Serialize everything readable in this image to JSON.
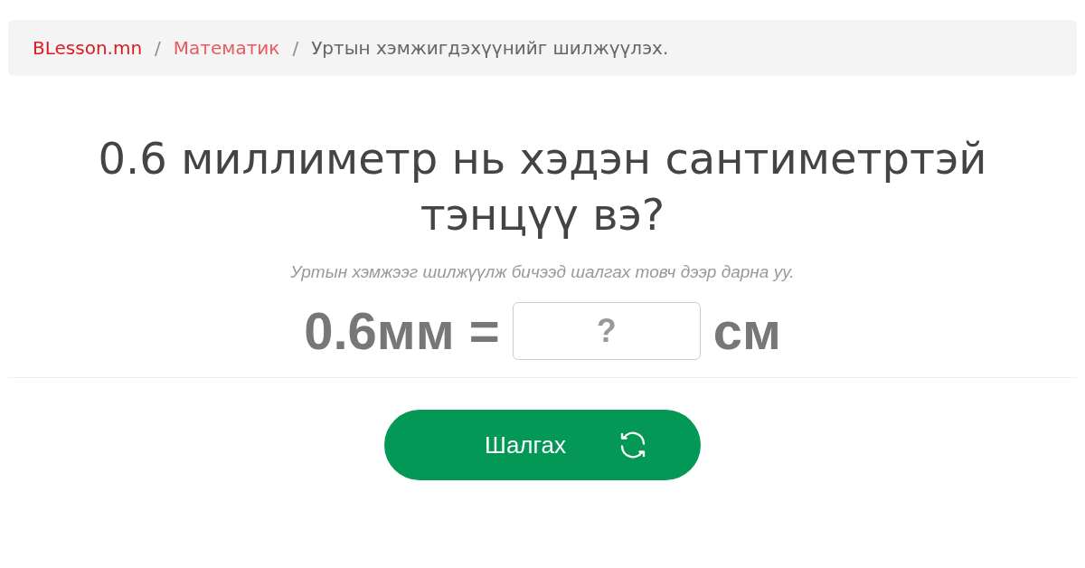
{
  "breadcrumb": [
    {
      "label": "BLesson.mn",
      "kind": "home"
    },
    {
      "label": "Математик",
      "kind": "link"
    },
    {
      "label": "Уртын хэмжигдэхүүнийг шилжүүлэх.",
      "kind": "current"
    }
  ],
  "breadcrumb_separator": "/",
  "question": "0.6 миллиметр нь хэдэн сантиметртэй тэнцүү вэ?",
  "hint": "Уртын хэмжээг шилжүүлж бичээд шалгах товч дээр дарна уу.",
  "equation": {
    "left": "0.6мм =",
    "answer": {
      "placeholder": "?"
    },
    "unit": "см"
  },
  "check_button": "Шалгах"
}
